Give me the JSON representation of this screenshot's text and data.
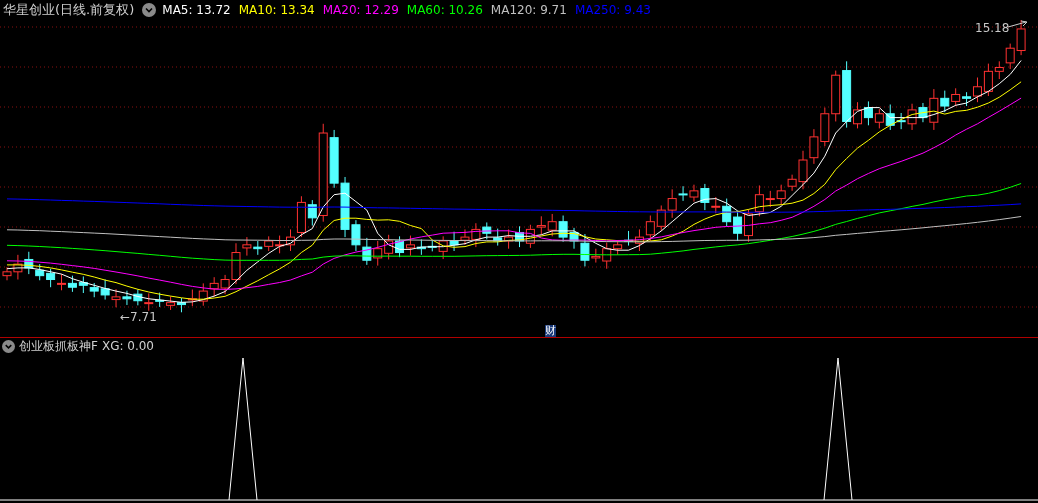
{
  "header": {
    "title": "华星创业(日线.前复权)",
    "ma_labels": [
      {
        "label": "MA5: 13.72",
        "color": "#ffffff"
      },
      {
        "label": "MA10: 13.34",
        "color": "#ffff00"
      },
      {
        "label": "MA20: 12.29",
        "color": "#ff00ff"
      },
      {
        "label": "MA60: 10.26",
        "color": "#00ff00"
      },
      {
        "label": "MA120: 9.71",
        "color": "#c0c0c0"
      },
      {
        "label": "MA250: 9.43",
        "color": "#0000ff"
      }
    ]
  },
  "main_chart": {
    "high_marker": "15.18",
    "low_marker": "←7.71",
    "event_marker": "财"
  },
  "indicator": {
    "title": "创业板抓板神F",
    "reading": "XG: 0.00"
  }
}
